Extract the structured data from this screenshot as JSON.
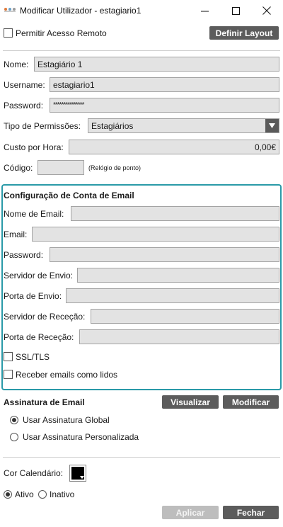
{
  "window": {
    "title": "Modificar Utilizador - estagiario1"
  },
  "top": {
    "remote_access_label": "Permitir Acesso Remoto",
    "remote_access_checked": false,
    "layout_button": "Definir Layout"
  },
  "user": {
    "name_label": "Nome:",
    "name_value": "Estagiário 1",
    "username_label": "Username:",
    "username_value": "estagiario1",
    "password_label": "Password:",
    "password_value": "***************",
    "permissions_label": "Tipo de Permissões:",
    "permissions_value": "Estagiários",
    "cost_label": "Custo por Hora:",
    "cost_value": "0,00€",
    "code_label": "Código:",
    "code_value": "",
    "code_note": "(Relógio de ponto)"
  },
  "email_account": {
    "heading": "Configuração de Conta de Email",
    "email_name_label": "Nome de Email:",
    "email_name_value": "",
    "email_label": "Email:",
    "email_value": "",
    "password_label": "Password:",
    "password_value": "",
    "smtp_server_label": "Servidor de Envio:",
    "smtp_server_value": "",
    "smtp_port_label": "Porta de Envio:",
    "smtp_port_value": "",
    "in_server_label": "Servidor de Receção:",
    "in_server_value": "",
    "in_port_label": "Porta de Receção:",
    "in_port_value": "",
    "ssl_label": "SSL/TLS",
    "ssl_checked": false,
    "mark_read_label": "Receber emails como lidos",
    "mark_read_checked": false
  },
  "signature": {
    "heading": "Assinatura de Email",
    "preview_button": "Visualizar",
    "modify_button": "Modificar",
    "global_label": "Usar Assinatura Global",
    "custom_label": "Usar Assinatura Personalizada",
    "selected": "global"
  },
  "calendar": {
    "color_label": "Cor Calendário:",
    "color": "#000000"
  },
  "status": {
    "active_label": "Ativo",
    "inactive_label": "Inativo",
    "selected": "active"
  },
  "footer": {
    "apply_button": "Aplicar",
    "close_button": "Fechar"
  },
  "colors": {
    "accent": "#2a9aa8",
    "button_dark": "#5c5c5c",
    "button_disabled": "#bdbdbd",
    "field_bg": "#e3e3e3"
  }
}
